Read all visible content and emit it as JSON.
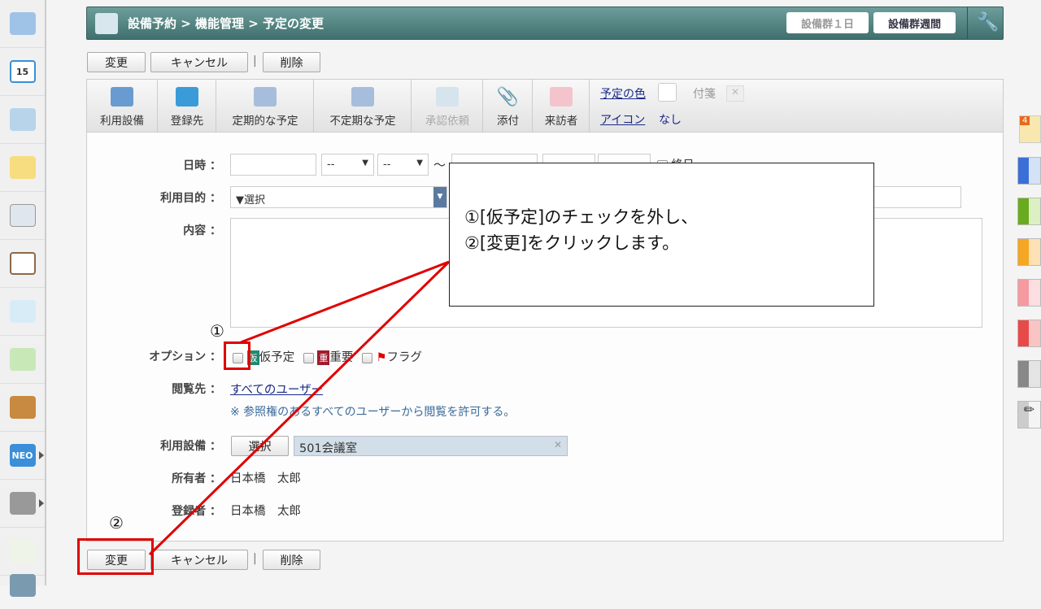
{
  "header": {
    "breadcrumb": "設備予約 > 機能管理 > 予定の変更",
    "day_button": "設備群１日",
    "week_button": "設備群週間"
  },
  "actions": {
    "change": "変更",
    "cancel": "キャンセル",
    "separator": "|",
    "delete": "削除"
  },
  "toolbar": {
    "items": [
      "利用設備",
      "登録先",
      "定期的な予定",
      "不定期な予定",
      "承認依頼",
      "添付",
      "来訪者"
    ],
    "color_link": "予定の色",
    "sticky": "付箋",
    "icon_link": "アイコン",
    "icon_value": "なし"
  },
  "form": {
    "datetime_label": "日時 ：",
    "time_placeholder": "--",
    "tilde": "～",
    "allday": "終日",
    "purpose_label": "利用目的 ：",
    "purpose_value": "▼選択",
    "content_label": "内容 ：",
    "option_label": "オプション ：",
    "option_tentative": "仮予定",
    "option_tentative_badge": "仮",
    "option_important": "重要",
    "option_important_badge": "重",
    "option_flag": "フラグ",
    "viewer_label": "閲覧先 ：",
    "viewer_value": "すべてのユーザー",
    "viewer_note": "※ 参照権のあるすべてのユーザーから閲覧を許可する。",
    "facility_label": "利用設備 ：",
    "facility_select": "選択",
    "facility_value": "501会議室",
    "owner_label": "所有者 ：",
    "owner_value": "日本橋　太郎",
    "registrant_label": "登録者 ：",
    "registrant_value": "日本橋　太郎"
  },
  "sidebar": {
    "calendar_day": "15",
    "neo": "NEO"
  },
  "right_tabs": {
    "badge": "4",
    "colors": [
      "#3b6fd6",
      "#6aaa1e",
      "#f5a623",
      "#f59aa0",
      "#e84a4a",
      "#888888"
    ]
  },
  "annotation": {
    "line1": "①[仮予定]のチェックを外し、",
    "line2": "②[変更]をクリックします。",
    "marker1": "①",
    "marker2": "②"
  }
}
